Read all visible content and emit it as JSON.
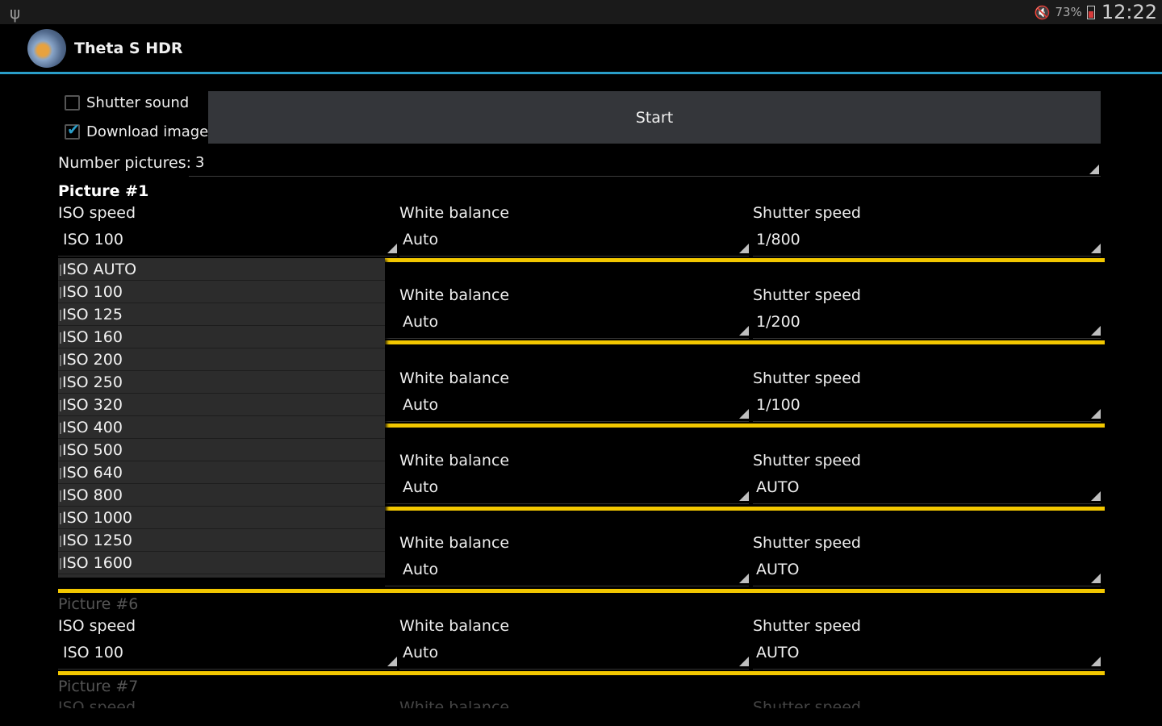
{
  "status": {
    "battery": "73%",
    "time": "12:22"
  },
  "app": {
    "title": "Theta S HDR"
  },
  "options": {
    "shutter_sound_label": "Shutter sound",
    "shutter_sound_checked": false,
    "download_images_label": "Download images",
    "download_images_checked": true,
    "start_label": "Start",
    "number_pictures_label": "Number pictures:",
    "number_pictures_value": "3"
  },
  "labels": {
    "iso": "ISO speed",
    "wb": "White balance",
    "shutter": "Shutter speed"
  },
  "picture1": {
    "title": "Picture #1",
    "iso": "ISO 100",
    "wb": "Auto",
    "shutter": "1/800"
  },
  "rows": [
    {
      "wb": "Auto",
      "shutter": "1/200"
    },
    {
      "wb": "Auto",
      "shutter": "1/100"
    },
    {
      "wb": "Auto",
      "shutter": "AUTO"
    },
    {
      "wb": "Auto",
      "shutter": "AUTO"
    }
  ],
  "picture6": {
    "title": "Picture #6",
    "iso": "ISO 100",
    "wb": "Auto",
    "shutter": "AUTO"
  },
  "picture7": {
    "title": "Picture #7"
  },
  "iso_dropdown": [
    "ISO AUTO",
    "ISO 100",
    "ISO 125",
    "ISO 160",
    "ISO 200",
    "ISO 250",
    "ISO 320",
    "ISO 400",
    "ISO 500",
    "ISO 640",
    "ISO 800",
    "ISO 1000",
    "ISO 1250",
    "ISO 1600"
  ],
  "colors": {
    "accent": "#2a9ec9",
    "separator": "#f2c700"
  }
}
